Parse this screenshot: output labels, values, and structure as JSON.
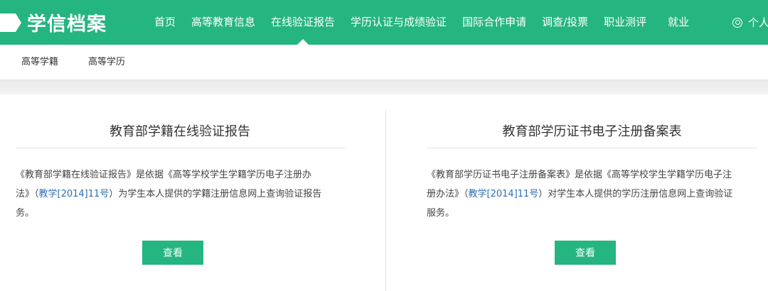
{
  "header": {
    "logo_text": "学信档案",
    "nav": [
      {
        "label": "首页"
      },
      {
        "label": "高等教育信息"
      },
      {
        "label": "在线验证报告"
      },
      {
        "label": "学历认证与成绩验证"
      },
      {
        "label": "国际合作申请"
      },
      {
        "label": "调查/投票"
      },
      {
        "label": "职业测评"
      },
      {
        "label": "就业"
      }
    ],
    "user_label": "个人"
  },
  "subnav": {
    "items": [
      {
        "label": "高等学籍"
      },
      {
        "label": "高等学历"
      }
    ]
  },
  "cards": [
    {
      "title": "教育部学籍在线验证报告",
      "desc_part1": "《教育部学籍在线验证报告》是依据《高等学校学生学籍学历电子注册办",
      "desc_part2a": "法》（",
      "desc_link": "教学[2014]11号",
      "desc_part2b": "）为学生本人提供的学籍注册信息网上查询验证报告",
      "desc_part3": "务。",
      "button": "查看"
    },
    {
      "title": "教育部学历证书电子注册备案表",
      "desc_part1": "《教育部学历证书电子注册备案表》是依据《高等学校学生学籍学历电子注",
      "desc_part2a": "册办法》（",
      "desc_link": "教学[2014]11号",
      "desc_part2b": "）对学生本人提供的学历注册信息网上查询验证",
      "desc_part3": "服务。",
      "button": "查看"
    }
  ],
  "colors": {
    "brand": "#25b580",
    "link": "#2b6fb6"
  }
}
